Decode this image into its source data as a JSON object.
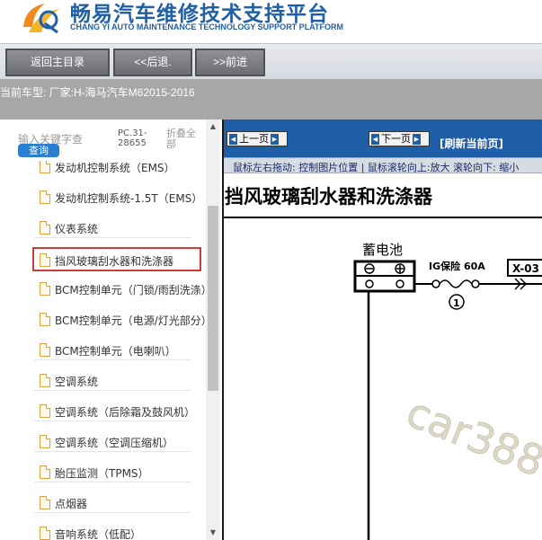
{
  "header": {
    "brand_cn": "畅易汽车维修技术支持平台",
    "brand_en": "CHANG YI AUTO MAINTENANCE TECHNOLOGY SUPPORT PLATFORM",
    "accent": "#1f5fa8"
  },
  "toolbar": {
    "home_label": "返回主目录",
    "back_label": "<<后退.",
    "forward_label": ">>前进"
  },
  "model_bar": {
    "text": "当前车型:  厂家:H-海马汽车M62015-2016"
  },
  "sidebar": {
    "search_placeholder": "输入关键字查",
    "query_label": "查询",
    "pc_code": "PC.31-28655",
    "collapse_label": "折叠全部",
    "items": [
      {
        "label": "发动机控制系统（EMS）"
      },
      {
        "label": "发动机控制系统-1.5T（EMS）"
      },
      {
        "label": "仪表系统"
      },
      {
        "label": "挡风玻璃刮水器和洗涤器"
      },
      {
        "label": "BCM控制单元（门锁/雨刮洗涤）"
      },
      {
        "label": "BCM控制单元（电源/灯光部分）"
      },
      {
        "label": "BCM控制单元（电喇叭）"
      },
      {
        "label": "空调系统"
      },
      {
        "label": "空调系统（后除霜及鼓风机）"
      },
      {
        "label": "空调系统（空调压缩机）"
      },
      {
        "label": "胎压监测（TPMS）"
      },
      {
        "label": "点烟器"
      },
      {
        "label": "音响系统（低配）"
      }
    ],
    "selected_index": 3
  },
  "viewer": {
    "prev_label": "上一页",
    "next_label": "下一页",
    "refresh_label": "[刷新当前页]",
    "hint": "鼠标左右拖动: 控制图片位置 | 鼠标滚轮向上:放大  滚轮向下: 缩小",
    "title": "挡风玻璃刮水器和洗涤器",
    "diagram": {
      "battery_label": "蓄电池",
      "fuse_label": "IG保险 60A",
      "fuse_number": "1",
      "connector_label": "X-03",
      "watermark": "car388"
    }
  }
}
